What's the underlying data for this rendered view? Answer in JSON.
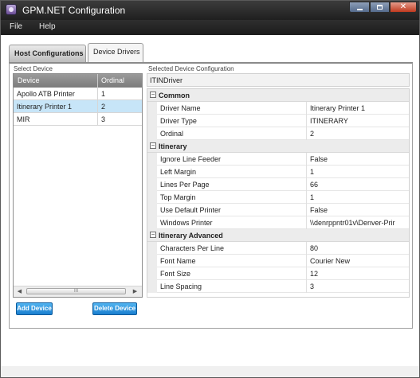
{
  "window": {
    "title": "GPM.NET Configuration",
    "controls": {
      "minimize": "min",
      "maximize": "max",
      "close": "✕"
    }
  },
  "menu": [
    "File",
    "Help"
  ],
  "tabs": [
    {
      "label": "Host Configurations",
      "active": true
    },
    {
      "label": "Device Drivers",
      "active": false
    }
  ],
  "left": {
    "label": "Select Device",
    "columns": [
      "Device",
      "Ordinal"
    ],
    "rows": [
      {
        "device": "Apollo ATB Printer",
        "ordinal": "1",
        "selected": false
      },
      {
        "device": "Itinerary Printer 1",
        "ordinal": "2",
        "selected": true
      },
      {
        "device": "MIR",
        "ordinal": "3",
        "selected": false
      }
    ],
    "scroll_left": "◀",
    "scroll_right": "▶",
    "scroll_thumb": "III",
    "add_button": "Add Device",
    "delete_button": "Delete Device"
  },
  "right": {
    "label": "Selected Device Configuration",
    "header": "ITINDriver",
    "categories": [
      {
        "name": "Common",
        "toggle": "−",
        "properties": [
          {
            "name": "Driver Name",
            "value": "Itinerary Printer 1"
          },
          {
            "name": "Driver Type",
            "value": "ITINERARY"
          },
          {
            "name": "Ordinal",
            "value": "2"
          }
        ]
      },
      {
        "name": "Itinerary",
        "toggle": "−",
        "properties": [
          {
            "name": "Ignore Line Feeder",
            "value": "False"
          },
          {
            "name": "Left Margin",
            "value": "1"
          },
          {
            "name": "Lines Per Page",
            "value": "66"
          },
          {
            "name": "Top Margin",
            "value": "1"
          },
          {
            "name": "Use Default Printer",
            "value": "False"
          },
          {
            "name": "Windows Printer",
            "value": "\\\\denrppntr01v\\Denver-Prir"
          }
        ]
      },
      {
        "name": "Itinerary Advanced",
        "toggle": "−",
        "properties": [
          {
            "name": "Characters Per Line",
            "value": "80"
          },
          {
            "name": "Font Name",
            "value": "Courier New"
          },
          {
            "name": "Font Size",
            "value": "12"
          },
          {
            "name": "Line Spacing",
            "value": "3"
          }
        ]
      }
    ]
  }
}
